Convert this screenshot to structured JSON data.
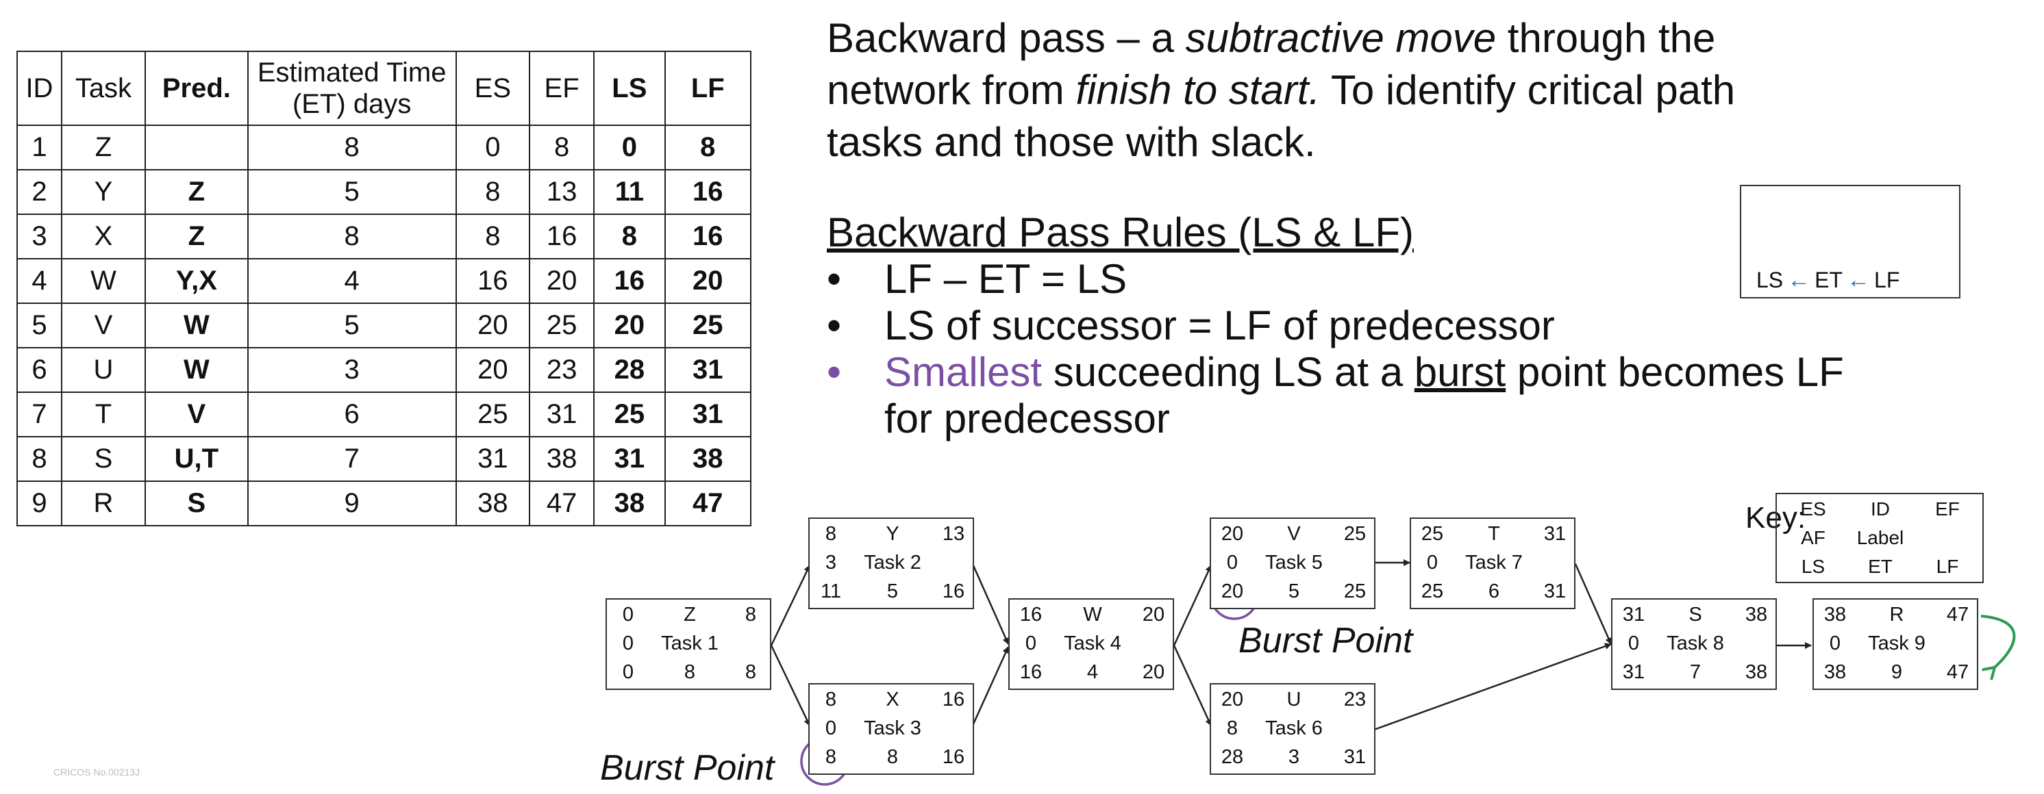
{
  "table": {
    "headers": [
      "ID",
      "Task",
      "Pred.",
      "Estimated Time (ET)  days",
      "ES",
      "EF",
      "LS",
      "LF"
    ],
    "header_line1": "Estimated Time",
    "header_line2": "(ET)  days",
    "rows": [
      [
        "1",
        "Z",
        "",
        "8",
        "0",
        "8",
        "0",
        "8"
      ],
      [
        "2",
        "Y",
        "Z",
        "5",
        "8",
        "13",
        "11",
        "16"
      ],
      [
        "3",
        "X",
        "Z",
        "8",
        "8",
        "16",
        "8",
        "16"
      ],
      [
        "4",
        "W",
        "Y,X",
        "4",
        "16",
        "20",
        "16",
        "20"
      ],
      [
        "5",
        "V",
        "W",
        "5",
        "20",
        "25",
        "20",
        "25"
      ],
      [
        "6",
        "U",
        "W",
        "3",
        "20",
        "23",
        "28",
        "31"
      ],
      [
        "7",
        "T",
        "V",
        "6",
        "25",
        "31",
        "25",
        "31"
      ],
      [
        "8",
        "S",
        "U,T",
        "7",
        "31",
        "38",
        "31",
        "38"
      ],
      [
        "9",
        "R",
        "S",
        "9",
        "38",
        "47",
        "38",
        "47"
      ]
    ]
  },
  "intro": {
    "p1": "Backward pass – a ",
    "p2": "subtractive move",
    "p3": " through the",
    "p4": "network from ",
    "p5": "finish to start.",
    "p6": " To identify critical path",
    "p7": "tasks and those with slack."
  },
  "rules": {
    "title": "Backward Pass Rules (LS & LF)",
    "bullet": "•",
    "r1": "LF – ET = LS",
    "r2": "LS of successor = LF of predecessor",
    "r3a": "Smallest",
    "r3b": " succeeding LS at a ",
    "r3c": "burst",
    "r3d": " point becomes LF",
    "r3e": "for predecessor"
  },
  "legend": {
    "ls": "LS",
    "et": "ET",
    "lf": "LF",
    "arrow": "←"
  },
  "key": {
    "label": "Key:",
    "cells": [
      "ES",
      "ID",
      "EF",
      "AF",
      "Label",
      "",
      "LS",
      "ET",
      "LF"
    ]
  },
  "nodes": {
    "z": [
      "0",
      "Z",
      "8",
      "0",
      "Task 1",
      "",
      "0",
      "8",
      "8"
    ],
    "y": [
      "8",
      "Y",
      "13",
      "3",
      "Task 2",
      "",
      "11",
      "5",
      "16"
    ],
    "x": [
      "8",
      "X",
      "16",
      "0",
      "Task 3",
      "",
      "8",
      "8",
      "16"
    ],
    "w": [
      "16",
      "W",
      "20",
      "0",
      "Task 4",
      "",
      "16",
      "4",
      "20"
    ],
    "v": [
      "20",
      "V",
      "25",
      "0",
      "Task 5",
      "",
      "20",
      "5",
      "25"
    ],
    "u": [
      "20",
      "U",
      "23",
      "8",
      "Task 6",
      "",
      "28",
      "3",
      "31"
    ],
    "t": [
      "25",
      "T",
      "31",
      "0",
      "Task 7",
      "",
      "25",
      "6",
      "31"
    ],
    "s": [
      "31",
      "S",
      "38",
      "0",
      "Task 8",
      "",
      "31",
      "7",
      "38"
    ],
    "r": [
      "38",
      "R",
      "47",
      "0",
      "Task 9",
      "",
      "38",
      "9",
      "47"
    ]
  },
  "burst_label": "Burst Point",
  "footer": "CRICOS No.00213J",
  "colors": {
    "purple": "#7b4fa3",
    "blue_arrow": "#2f6fb0",
    "green_arrow": "#2e9a57"
  }
}
